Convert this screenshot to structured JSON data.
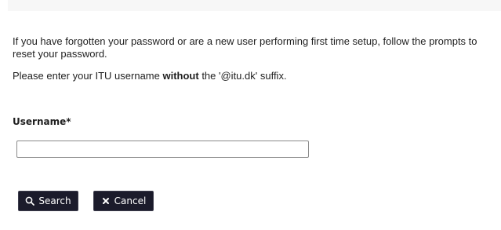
{
  "form": {
    "intro_text": "If you have forgotten your password or are a new user performing first time setup, follow the prompts to reset your password.",
    "instruction_prefix": "Please enter your ITU username ",
    "instruction_bold": "without",
    "instruction_suffix": " the '@itu.dk' suffix.",
    "username_label": "Username*",
    "username_value": "",
    "search_label": "Search",
    "cancel_label": "Cancel"
  },
  "icons": {
    "search": "search-icon",
    "cancel": "close-icon"
  },
  "colors": {
    "button_bg": "#1b1b2b",
    "button_text": "#ffffff",
    "text": "#1f1f1f",
    "input_border": "#8a8a8a"
  }
}
